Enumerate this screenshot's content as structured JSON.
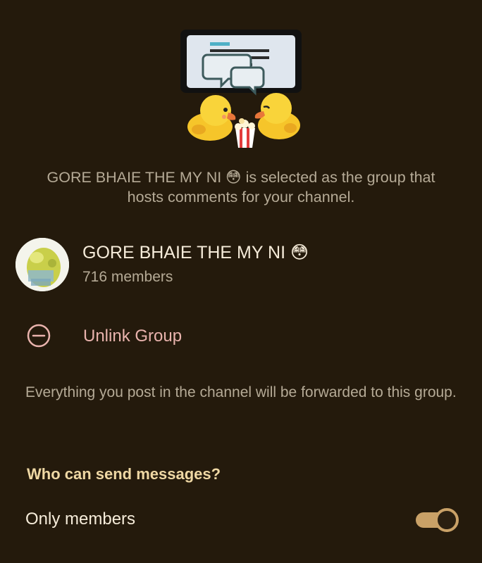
{
  "header": {
    "selected_group": "GORE BHAIE THE MY NI 😳",
    "selected_suffix": " is selected as the group that hosts comments for your channel."
  },
  "group": {
    "name": "GORE BHAIE THE MY NI 😳",
    "members": "716 members"
  },
  "actions": {
    "unlink_label": "Unlink Group"
  },
  "notes": {
    "forward_text": "Everything you post in the channel will be forwarded to this group."
  },
  "permissions": {
    "section_title": "Who can send messages?",
    "only_members_label": "Only members",
    "only_members_enabled": true
  },
  "colors": {
    "background": "#241a0c",
    "accent": "#c9a167",
    "destructive": "#e9b3ad"
  }
}
